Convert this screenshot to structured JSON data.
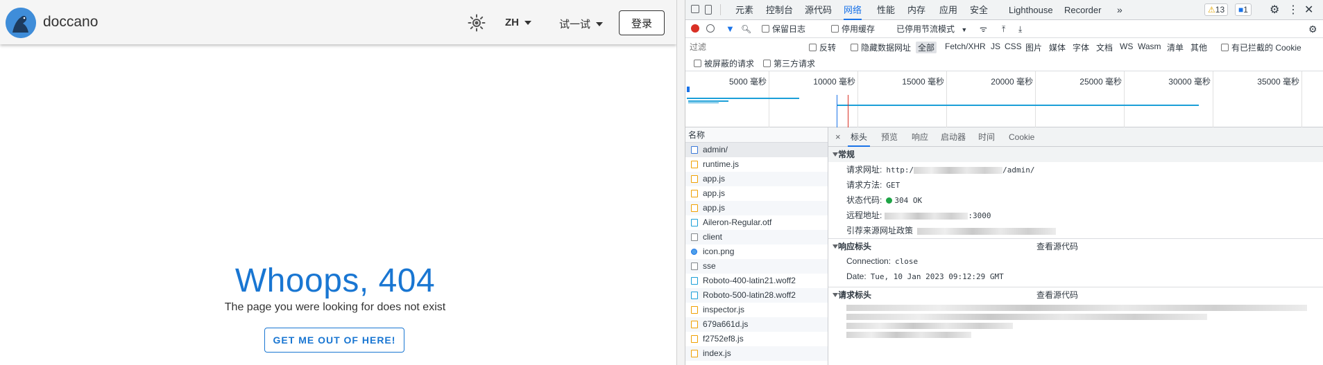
{
  "app": {
    "brand": "doccano",
    "lang": "ZH",
    "try_label": "试一试",
    "login_label": "登录",
    "not_found_title": "Whoops, 404",
    "not_found_text": "The page you were looking for does not exist",
    "back_button": "GET ME OUT OF HERE!"
  },
  "devtools": {
    "tabs": [
      "元素",
      "控制台",
      "源代码",
      "网络",
      "性能",
      "内存",
      "应用",
      "安全",
      "Lighthouse",
      "Recorder"
    ],
    "active_tab": "网络",
    "warnings": "13",
    "messages": "1",
    "toolbar": {
      "preserve_log": "保留日志",
      "disable_cache": "停用缓存",
      "throttling": "已停用节流模式"
    },
    "filter": {
      "placeholder": "过滤",
      "invert": "反转",
      "hide_data_urls": "隐藏数据网址",
      "types": [
        "全部",
        "Fetch/XHR",
        "JS",
        "CSS",
        "图片",
        "媒体",
        "字体",
        "文档",
        "WS",
        "Wasm",
        "清单",
        "其他"
      ],
      "blocked_cookies": "有已拦截的 Cookie",
      "blocked_requests": "被屏蔽的请求",
      "third_party": "第三方请求"
    },
    "timeline_ticks": [
      "5000 毫秒",
      "10000 毫秒",
      "15000 毫秒",
      "20000 毫秒",
      "25000 毫秒",
      "30000 毫秒",
      "35000 毫秒"
    ],
    "list_header": "名称",
    "requests": [
      "admin/",
      "runtime.js",
      "app.js",
      "app.js",
      "app.js",
      "Aileron-Regular.otf",
      "client",
      "icon.png",
      "sse",
      "Roboto-400-latin21.woff2",
      "Roboto-500-latin28.woff2",
      "inspector.js",
      "679a661d.js",
      "f2752ef8.js",
      "index.js"
    ],
    "detail_tabs": [
      "标头",
      "预览",
      "响应",
      "启动器",
      "时间",
      "Cookie"
    ],
    "general": {
      "title": "常规",
      "url_label": "请求网址:",
      "url_prefix": "http:/",
      "url_suffix": "/admin/",
      "method_label": "请求方法:",
      "method": "GET",
      "status_label": "状态代码:",
      "status": "304 OK",
      "remote_label": "远程地址:",
      "remote_port": ":3000",
      "referrer_label": "引荐来源网址政策"
    },
    "response_headers": {
      "title": "响应标头",
      "view_source": "查看源代码",
      "connection_label": "Connection:",
      "connection": "close",
      "date_label": "Date:",
      "date": "Tue, 10 Jan 2023 09:12:29 GMT"
    },
    "request_headers": {
      "title": "请求标头",
      "view_source": "查看源代码"
    }
  }
}
